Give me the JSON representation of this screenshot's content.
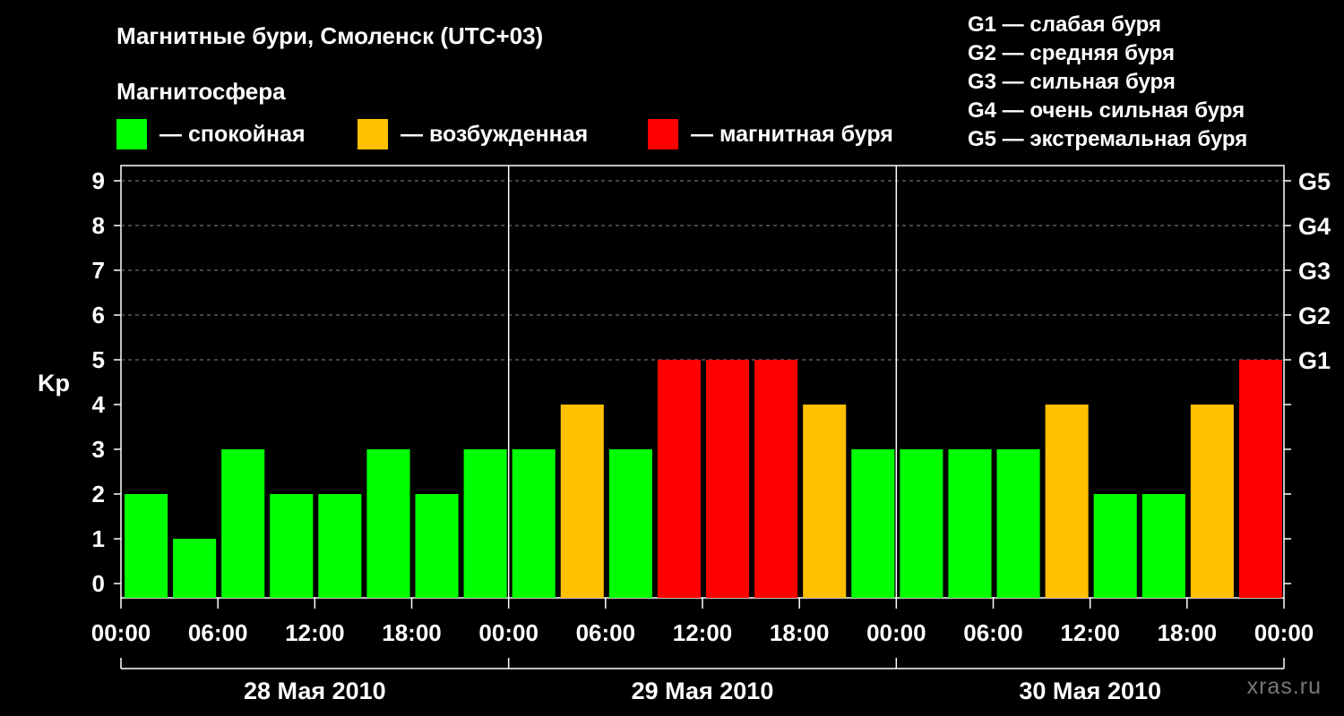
{
  "header": {
    "title": "Магнитные бури, Смоленск (UTC+03)",
    "magnetosphere_title": "Магнитосфера"
  },
  "legend": [
    {
      "label": "— спокойная",
      "color": "#00ff00"
    },
    {
      "label": "— возбужденная",
      "color": "#ffc000"
    },
    {
      "label": "— магнитная буря",
      "color": "#ff0000"
    }
  ],
  "g_scale": [
    "G1 — слабая буря",
    "G2 — средняя буря",
    "G3 — сильная буря",
    "G4 — очень сильная буря",
    "G5 — экстремальная буря"
  ],
  "watermark": "xras.ru",
  "chart_data": {
    "type": "bar",
    "ylabel": "Kp",
    "ylim": [
      0,
      9
    ],
    "y_ticks": [
      "0",
      "1",
      "2",
      "3",
      "4",
      "5",
      "6",
      "7",
      "8",
      "9"
    ],
    "g_ticks": [
      {
        "kp": 5,
        "label": "G1"
      },
      {
        "kp": 6,
        "label": "G2"
      },
      {
        "kp": 7,
        "label": "G3"
      },
      {
        "kp": 8,
        "label": "G4"
      },
      {
        "kp": 9,
        "label": "G5"
      }
    ],
    "x_tick_labels": [
      "00:00",
      "06:00",
      "12:00",
      "18:00",
      "00:00",
      "06:00",
      "12:00",
      "18:00",
      "00:00",
      "06:00",
      "12:00",
      "18:00",
      "00:00"
    ],
    "days": [
      "28 Мая 2010",
      "29 Мая 2010",
      "30 Мая 2010"
    ],
    "values": [
      2,
      1,
      3,
      2,
      2,
      3,
      2,
      3,
      3,
      4,
      3,
      5,
      5,
      5,
      4,
      3,
      3,
      3,
      3,
      4,
      2,
      2,
      4,
      5
    ],
    "color_scale": {
      "calm": "#00ff00",
      "active": "#ffc000",
      "storm": "#ff0000"
    },
    "grid": true
  }
}
